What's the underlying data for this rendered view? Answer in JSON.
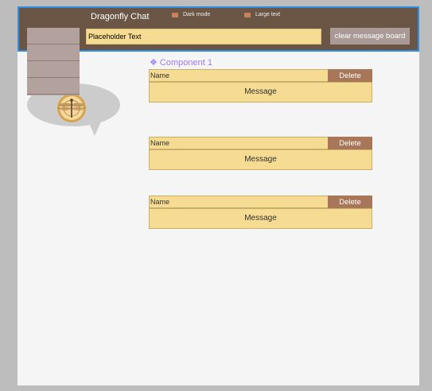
{
  "header": {
    "title": "Dragonfly  Chat",
    "toggles": [
      {
        "label": "Dark mode"
      },
      {
        "label": "Large text"
      }
    ],
    "input": {
      "placeholder": "Placeholder Text"
    },
    "clear_label": "clear message board"
  },
  "component_label": "❖ Component 1",
  "messages": [
    {
      "name": "Name",
      "delete_label": "Delete",
      "message": "Message"
    },
    {
      "name": "Name",
      "delete_label": "Delete",
      "message": "Message"
    },
    {
      "name": "Name",
      "delete_label": "Delete",
      "message": "Message"
    }
  ],
  "colors": {
    "header_bg": "#6b5645",
    "header_border": "#2f8fe6",
    "card_bg": "#f6dc93",
    "delete_bg": "#a87659",
    "clear_bg": "#a99a98",
    "component_label": "#9d7bf3"
  },
  "icons": {
    "logo": "dragonfly-logo",
    "toggle": "toggle-switch-icon"
  }
}
